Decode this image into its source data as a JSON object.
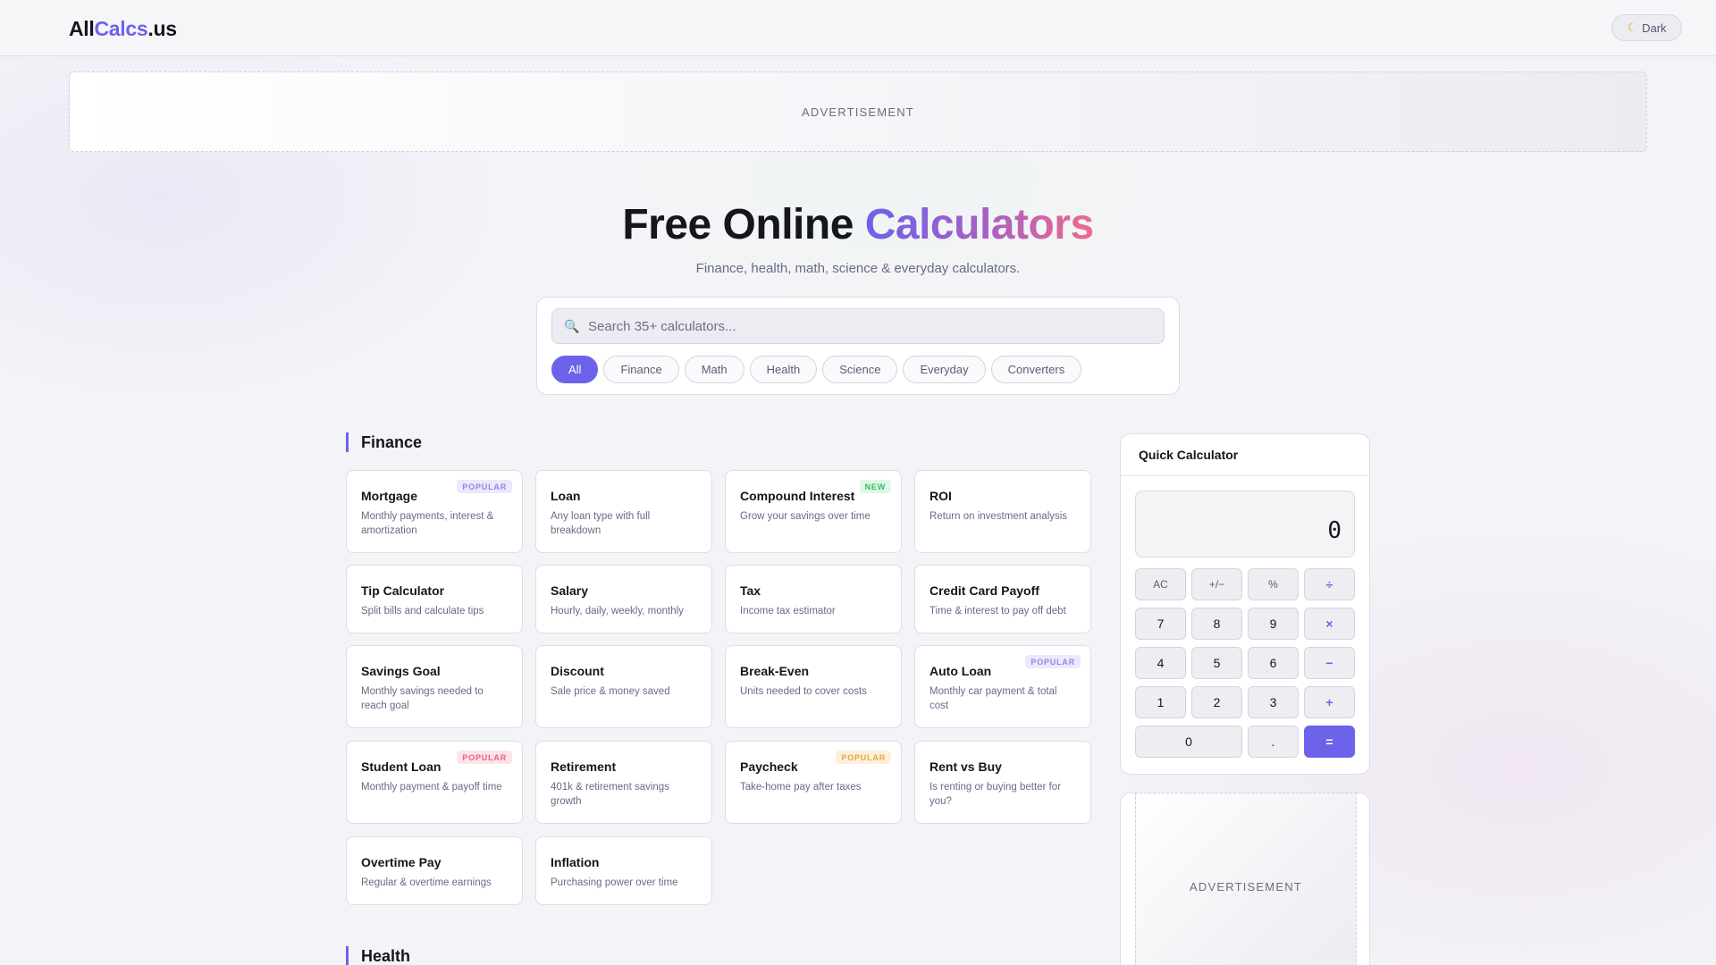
{
  "header": {
    "logo_prefix": "All",
    "logo_accent": "Calcs",
    "logo_suffix": ".us",
    "theme_toggle": {
      "icon": "moon-icon",
      "label": "Dark"
    }
  },
  "ads": {
    "top_label": "ADVERTISEMENT",
    "side_label": "ADVERTISEMENT"
  },
  "hero": {
    "title_plain": "Free Online ",
    "title_gradient": "Calculators",
    "subtitle": "Finance, health, math, science & everyday calculators."
  },
  "search": {
    "placeholder": "Search 35+ calculators...",
    "value": "",
    "icon": "search-icon"
  },
  "filters": [
    {
      "label": "All",
      "active": true
    },
    {
      "label": "Finance",
      "active": false
    },
    {
      "label": "Math",
      "active": false
    },
    {
      "label": "Health",
      "active": false
    },
    {
      "label": "Science",
      "active": false
    },
    {
      "label": "Everyday",
      "active": false
    },
    {
      "label": "Converters",
      "active": false
    }
  ],
  "sections": {
    "finance": {
      "title": "Finance",
      "cards": [
        {
          "title": "Mortgage",
          "desc": "Monthly payments, interest & amortization",
          "badge": "POPULAR"
        },
        {
          "title": "Loan",
          "desc": "Any loan type with full breakdown",
          "badge": ""
        },
        {
          "title": "Compound Interest",
          "desc": "Grow your savings over time",
          "badge": "NEW"
        },
        {
          "title": "ROI",
          "desc": "Return on investment analysis",
          "badge": ""
        },
        {
          "title": "Tip Calculator",
          "desc": "Split bills and calculate tips",
          "badge": ""
        },
        {
          "title": "Salary",
          "desc": "Hourly, daily, weekly, monthly",
          "badge": ""
        },
        {
          "title": "Tax",
          "desc": "Income tax estimator",
          "badge": ""
        },
        {
          "title": "Credit Card Payoff",
          "desc": "Time & interest to pay off debt",
          "badge": ""
        },
        {
          "title": "Savings Goal",
          "desc": "Monthly savings needed to reach goal",
          "badge": ""
        },
        {
          "title": "Discount",
          "desc": "Sale price & money saved",
          "badge": ""
        },
        {
          "title": "Break-Even",
          "desc": "Units needed to cover costs",
          "badge": ""
        },
        {
          "title": "Auto Loan",
          "desc": "Monthly car payment & total cost",
          "badge": "POPULAR"
        },
        {
          "title": "Student Loan",
          "desc": "Monthly payment & payoff time",
          "badge": "POPULAR"
        },
        {
          "title": "Retirement",
          "desc": "401k & retirement savings growth",
          "badge": ""
        },
        {
          "title": "Paycheck",
          "desc": "Take-home pay after taxes",
          "badge": "POPULAR"
        },
        {
          "title": "Rent vs Buy",
          "desc": "Is renting or buying better for you?",
          "badge": ""
        },
        {
          "title": "Overtime Pay",
          "desc": "Regular & overtime earnings",
          "badge": ""
        },
        {
          "title": "Inflation",
          "desc": "Purchasing power over time",
          "badge": ""
        }
      ]
    },
    "health": {
      "title": "Health"
    }
  },
  "quick_calc": {
    "title": "Quick Calculator",
    "display": "0",
    "keys": [
      "AC",
      "+/−",
      "%",
      "÷",
      "7",
      "8",
      "9",
      "×",
      "4",
      "5",
      "6",
      "−",
      "1",
      "2",
      "3",
      "+",
      "0",
      ".",
      "="
    ]
  },
  "colors": {
    "accent": "#6c63ea",
    "gradient_end": "#ee6b8c",
    "badge_new": "#3bb865",
    "badge_popular_red": "#e8617f",
    "badge_popular_amber": "#e6a53a"
  }
}
